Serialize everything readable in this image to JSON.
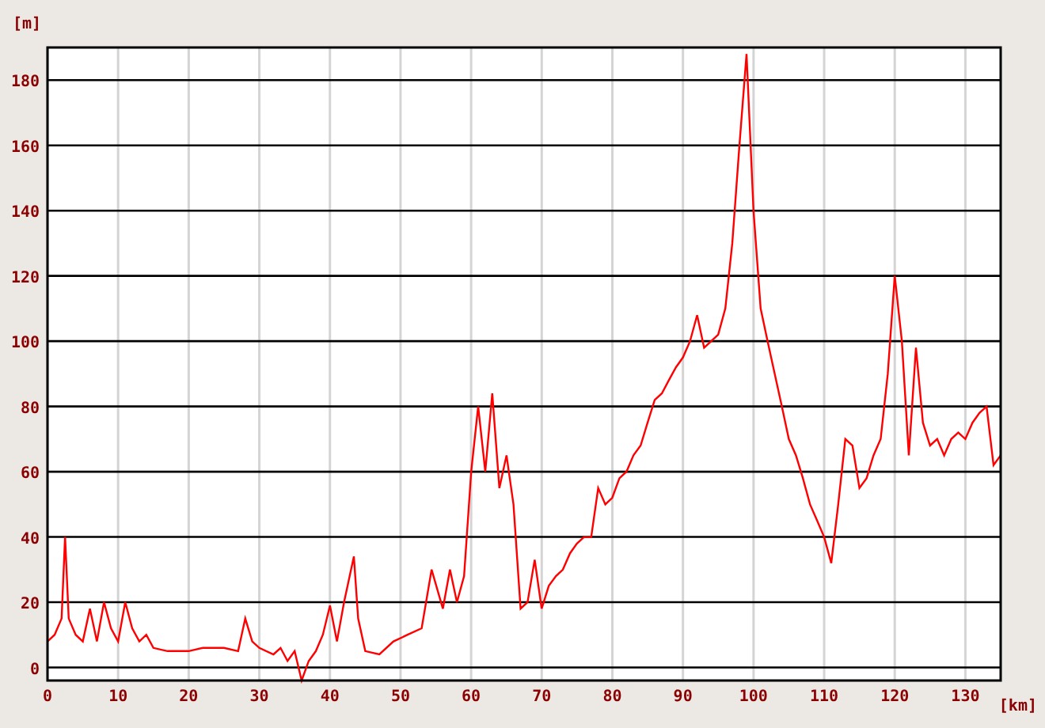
{
  "chart_data": {
    "type": "line",
    "grid": true,
    "xlabel": "[km]",
    "ylabel": "[m]",
    "xlim": [
      0,
      135
    ],
    "ylim": [
      -4,
      190
    ],
    "xticks": [
      0,
      10,
      20,
      30,
      40,
      50,
      60,
      70,
      80,
      90,
      100,
      110,
      120,
      130
    ],
    "yticks": [
      0,
      20,
      40,
      60,
      80,
      100,
      120,
      140,
      160,
      180
    ],
    "x": [
      0,
      1,
      2,
      2.5,
      3,
      4,
      5,
      6,
      7,
      8,
      9,
      10,
      11,
      12,
      13,
      14,
      15,
      17,
      20,
      22,
      25,
      27,
      28,
      29,
      30,
      32,
      33,
      34,
      35,
      36,
      37,
      38,
      39,
      40,
      41,
      42,
      43.4,
      44,
      45,
      47,
      49,
      51,
      53,
      54.4,
      56,
      57,
      58,
      59,
      60,
      61,
      62,
      63,
      64,
      65,
      66,
      67,
      68,
      69,
      70,
      71,
      72,
      73,
      74,
      75,
      76,
      77,
      78,
      79,
      80,
      81,
      82,
      83,
      84,
      85,
      86,
      87,
      88,
      89,
      90,
      91,
      92,
      93,
      94,
      95,
      96,
      97,
      98,
      99,
      100,
      101,
      102,
      103,
      104,
      105,
      106,
      107,
      108,
      109,
      110,
      111,
      112,
      113,
      114,
      115,
      116,
      117,
      118,
      119,
      120,
      121,
      122,
      123,
      124,
      125,
      126,
      127,
      128,
      129,
      130,
      131,
      132,
      133,
      134,
      135
    ],
    "series": [
      {
        "color": "#ff0000",
        "values": [
          8,
          10,
          15,
          40,
          15,
          10,
          8,
          18,
          8,
          20,
          12,
          8,
          20,
          12,
          8,
          10,
          6,
          5,
          5,
          6,
          6,
          5,
          15,
          8,
          6,
          4,
          6,
          2,
          5,
          -4,
          2,
          5,
          10,
          19,
          8,
          20,
          34,
          15,
          5,
          4,
          8,
          10,
          12,
          30,
          18,
          30,
          20,
          28,
          60,
          80,
          60,
          84,
          55,
          65,
          50,
          18,
          20,
          33,
          18,
          25,
          28,
          30,
          35,
          38,
          40,
          40,
          55,
          50,
          52,
          58,
          60,
          65,
          68,
          75,
          82,
          84,
          88,
          92,
          95,
          100,
          108,
          98,
          100,
          102,
          110,
          130,
          160,
          188,
          140,
          110,
          100,
          90,
          80,
          70,
          65,
          58,
          50,
          45,
          40,
          32,
          50,
          70,
          68,
          55,
          58,
          65,
          70,
          90,
          120,
          100,
          65,
          98,
          75,
          68,
          70,
          65,
          70,
          72,
          70,
          75,
          78,
          80,
          62,
          65
        ]
      }
    ]
  }
}
